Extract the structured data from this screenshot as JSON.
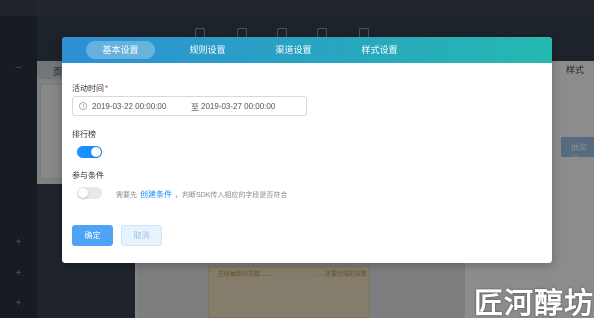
{
  "background": {
    "left_tab": "页",
    "right_tab": "样式",
    "right_button": "抽奖设",
    "canvas_left_text": "已经抽奖的次数……",
    "canvas_right_text": "……还要完成的次数"
  },
  "watermark": "匠河醇坊",
  "modal": {
    "tabs": [
      {
        "label": "基本设置",
        "active": true
      },
      {
        "label": "规则设置",
        "active": false
      },
      {
        "label": "渠道设置",
        "active": false
      },
      {
        "label": "样式设置",
        "active": false
      }
    ],
    "activity_time": {
      "label": "活动时间",
      "required_mark": "*",
      "start": "2019-03-22 00:00:00",
      "separator": "至",
      "end": "2019-03-27 00:00:00"
    },
    "leaderboard": {
      "label": "排行榜",
      "enabled": true
    },
    "participation": {
      "label": "参与条件",
      "enabled": false,
      "hint_prefix": "需要先",
      "hint_link": "创建条件",
      "hint_suffix": "，判断SDK传入相应的字段是否符合"
    },
    "buttons": {
      "confirm": "确定",
      "cancel": "取消"
    }
  },
  "colors": {
    "tab_gradient_start": "#2d8fd5",
    "tab_gradient_end": "#25b8b0",
    "primary": "#1890ff",
    "required": "#f5222d"
  }
}
